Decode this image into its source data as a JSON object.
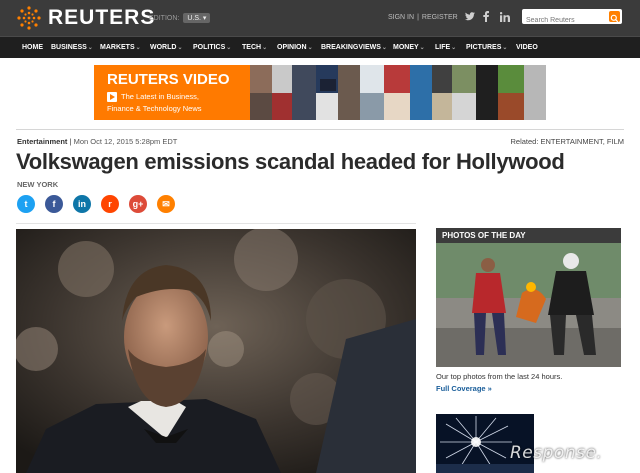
{
  "header": {
    "logo_text": "REUTERS",
    "edition_label": "EDITION:",
    "edition_value": "U.S.",
    "sign_in": "SIGN IN",
    "register": "REGISTER",
    "search_placeholder": "Search Reuters",
    "social_icons": [
      "twitter-icon",
      "facebook-icon",
      "linkedin-icon"
    ]
  },
  "nav": [
    {
      "label": "HOME",
      "has_menu": false
    },
    {
      "label": "BUSINESS",
      "has_menu": true
    },
    {
      "label": "MARKETS",
      "has_menu": true
    },
    {
      "label": "WORLD",
      "has_menu": true
    },
    {
      "label": "POLITICS",
      "has_menu": true
    },
    {
      "label": "TECH",
      "has_menu": true
    },
    {
      "label": "OPINION",
      "has_menu": true
    },
    {
      "label": "BREAKINGVIEWS",
      "has_menu": true
    },
    {
      "label": "MONEY",
      "has_menu": true
    },
    {
      "label": "LIFE",
      "has_menu": true
    },
    {
      "label": "PICTURES",
      "has_menu": true
    },
    {
      "label": "VIDEO",
      "has_menu": false
    }
  ],
  "banner": {
    "title": "REUTERS VIDEO",
    "line1": "The Latest in Business,",
    "line2": "Finance & Technology News",
    "accent": "#ff7a00"
  },
  "article": {
    "category": "Entertainment",
    "date": "Mon Oct 12, 2015 5:28pm EDT",
    "related_label": "Related:",
    "related_value": "ENTERTAINMENT, FILM",
    "headline": "Volkswagen emissions scandal headed for Hollywood",
    "dateline": "NEW YORK",
    "share_icons": [
      {
        "name": "twitter-share-icon",
        "glyph": "t",
        "color": "#1da1f2"
      },
      {
        "name": "facebook-share-icon",
        "glyph": "f",
        "color": "#3b5998"
      },
      {
        "name": "linkedin-share-icon",
        "glyph": "in",
        "color": "#0e76a8"
      },
      {
        "name": "reddit-share-icon",
        "glyph": "r",
        "color": "#ff4500"
      },
      {
        "name": "googleplus-share-icon",
        "glyph": "g+",
        "color": "#dd4b39"
      },
      {
        "name": "email-share-icon",
        "glyph": "✉",
        "color": "#ff8000"
      }
    ]
  },
  "sidebar": {
    "heading": "PHOTOS OF THE DAY",
    "caption": "Our top photos from the last 24 hours.",
    "link": "Full Coverage »"
  },
  "watermark": "Response."
}
